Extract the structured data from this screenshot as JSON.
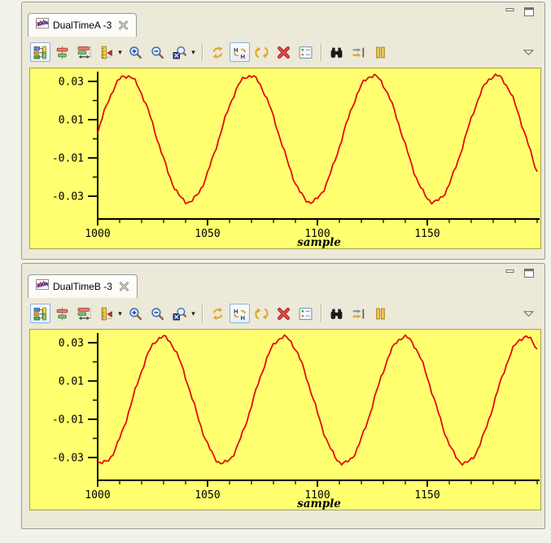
{
  "colors": {
    "plot_background": "#ffff70",
    "line_red": "#e40000",
    "chrome_beige": "#ece9d8",
    "panel_border": "#9a9b9c",
    "workbench_background": "#f3f2ea",
    "gold_icon": "#dfa92a"
  },
  "window_controls": [
    "minimize",
    "maximize"
  ],
  "toolbar": {
    "items": [
      {
        "name": "signal-tree-toggle",
        "pressed": true
      },
      {
        "name": "align-signals"
      },
      {
        "name": "time-scale"
      },
      {
        "name": "ruler-cursor",
        "dropdown": true
      },
      {
        "name": "zoom-in"
      },
      {
        "name": "zoom-out"
      },
      {
        "name": "zoom-region",
        "dropdown": true
      },
      {
        "sep": true
      },
      {
        "name": "swap-direction"
      },
      {
        "name": "swap-hex",
        "pressed": true
      },
      {
        "name": "rotate-signals"
      },
      {
        "name": "remove-signal"
      },
      {
        "name": "signal-properties"
      },
      {
        "sep": true
      },
      {
        "name": "find"
      },
      {
        "name": "goto-cursor"
      },
      {
        "name": "pause"
      },
      {
        "spacer": true
      },
      {
        "name": "view-menu"
      }
    ]
  },
  "panels": [
    {
      "tab": {
        "title": "DualTimeA -3"
      },
      "chart_data": {
        "type": "line",
        "xlabel": "sample",
        "ylabel": "",
        "xlim": [
          1000,
          1200
        ],
        "ylim": [
          -0.042,
          0.036
        ],
        "x_major_ticks": [
          1000,
          1050,
          1100,
          1150
        ],
        "x_tick_labels": [
          "1000",
          "1050",
          "1100",
          "1150"
        ],
        "x_minor_step": 10,
        "y_major_ticks": [
          0.03,
          0.01,
          -0.01,
          -0.03
        ],
        "y_tick_labels": [
          "0.03",
          "0.01",
          "-0.01",
          "-0.03"
        ],
        "y_minor_ticks": [
          0.02,
          0,
          -0.02
        ],
        "grid": false,
        "line_color": "#e40000",
        "background": "#ffff70",
        "wave": {
          "amplitude": 0.033,
          "period_samples": 56,
          "phase_rad_at_x_start": 0.1,
          "noise_amplitude": 0.0007
        },
        "samples": {
          "x0": 1000,
          "x_step": 5,
          "values": [
            0.0033,
            0.0203,
            0.031,
            0.0323,
            0.0236,
            0.0077,
            -0.0105,
            -0.0255,
            -0.0327,
            -0.0299,
            -0.0179,
            -0.0004,
            0.0172,
            0.0296,
            0.0328,
            0.0261,
            0.0113,
            -0.007,
            -0.0231,
            -0.0321,
            -0.0313,
            -0.0209,
            -0.0041,
            0.014,
            0.0277,
            0.033,
            0.0282,
            0.0147,
            -0.0033,
            -0.0203,
            -0.031,
            -0.0323,
            -0.0236,
            -0.0077,
            0.0105,
            0.0255,
            0.0327,
            0.0299,
            0.0179,
            0.0004,
            -0.0172
          ]
        }
      }
    },
    {
      "tab": {
        "title": "DualTimeB -3"
      },
      "chart_data": {
        "type": "line",
        "xlabel": "sample",
        "ylabel": "",
        "xlim": [
          1000,
          1200
        ],
        "ylim": [
          -0.042,
          0.036
        ],
        "x_major_ticks": [
          1000,
          1050,
          1100,
          1150
        ],
        "x_tick_labels": [
          "1000",
          "1050",
          "1100",
          "1150"
        ],
        "x_minor_step": 10,
        "y_major_ticks": [
          0.03,
          0.01,
          -0.01,
          -0.03
        ],
        "y_tick_labels": [
          "0.03",
          "0.01",
          "-0.01",
          "-0.03"
        ],
        "y_minor_ticks": [
          0.02,
          0,
          -0.02
        ],
        "grid": false,
        "line_color": "#e40000",
        "background": "#ffff70",
        "wave": {
          "amplitude": 0.033,
          "period_samples": 55,
          "phase_rad_at_x_start": -1.7993,
          "noise_amplitude": 0.0007
        },
        "samples": {
          "x0": 1000,
          "x_step": 5,
          "values": [
            -0.0321,
            -0.0311,
            -0.0201,
            -0.0028,
            0.0154,
            0.0287,
            0.0329,
            0.0267,
            0.0119,
            -0.0066,
            -0.023,
            -0.0321,
            -0.0311,
            -0.0201,
            -0.0028,
            0.0154,
            0.0287,
            0.0329,
            0.0267,
            0.0119,
            -0.0066,
            -0.023,
            -0.0321,
            -0.0311,
            -0.0201,
            -0.0028,
            0.0154,
            0.0287,
            0.0329,
            0.0267,
            0.0119,
            -0.0066,
            -0.023,
            -0.0321,
            -0.0311,
            -0.0201,
            -0.0028,
            0.0154,
            0.0287,
            0.0329,
            0.0267
          ]
        }
      }
    }
  ]
}
